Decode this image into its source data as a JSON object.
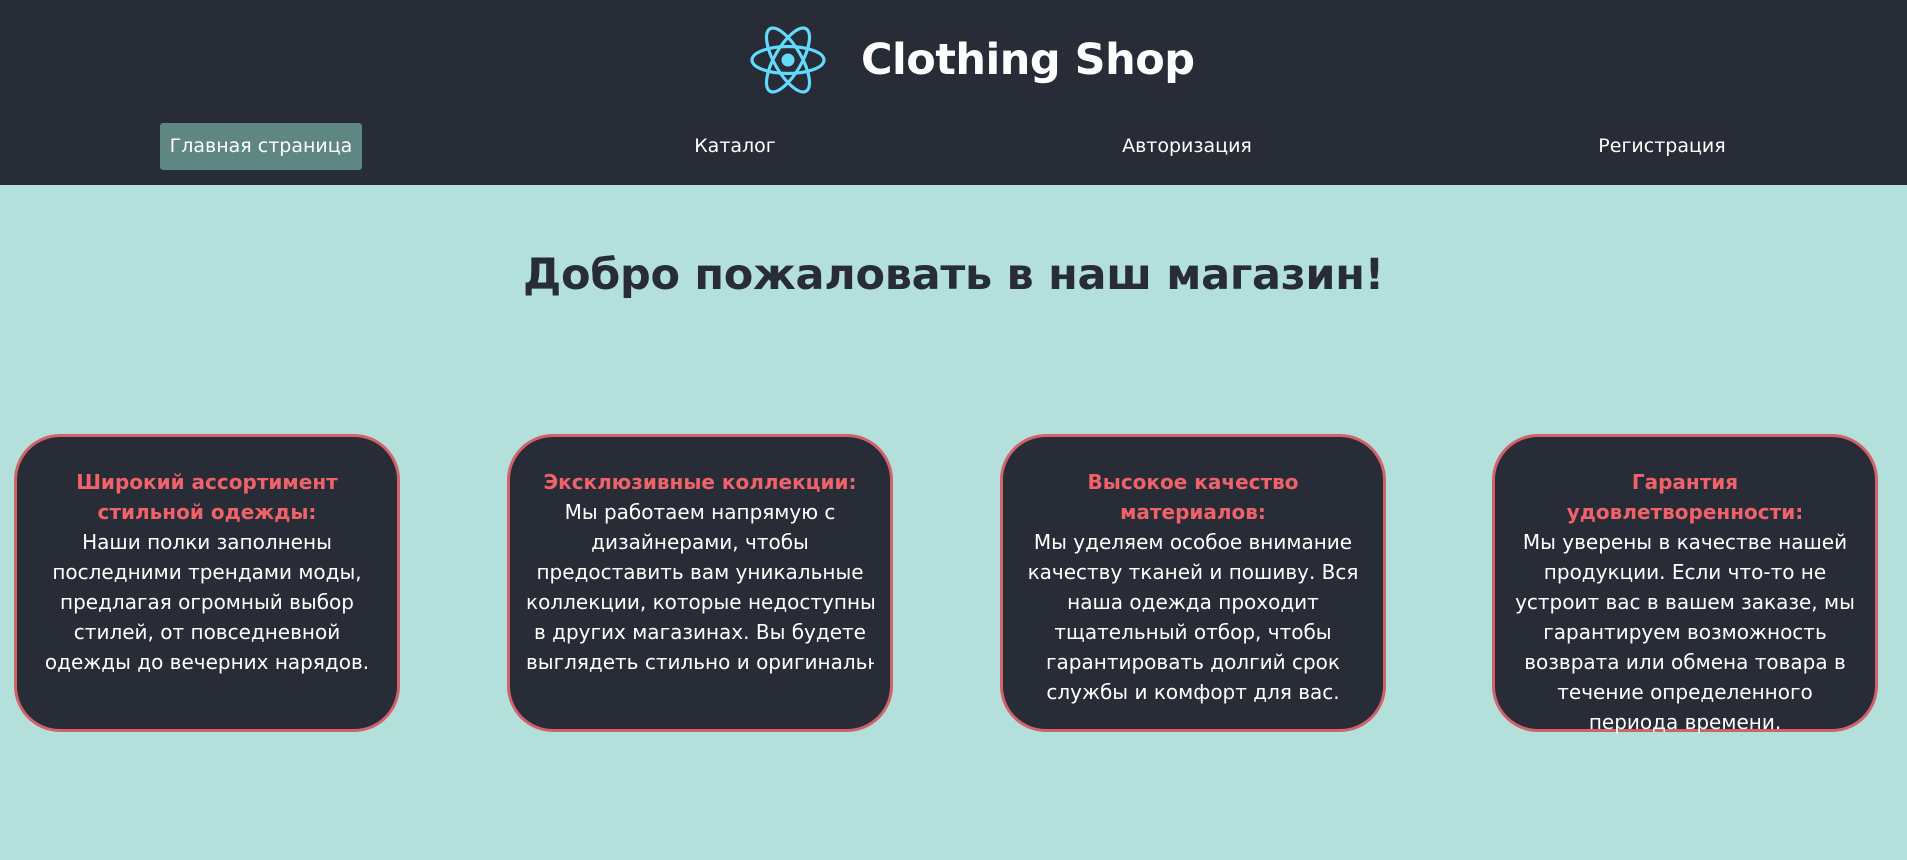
{
  "header": {
    "logo_icon": "react-atom-icon",
    "logo_color": "#61dafb",
    "title": "Clothing Shop",
    "background": "#282c36"
  },
  "nav": {
    "items": [
      {
        "label": "Главная страница",
        "active": true
      },
      {
        "label": "Каталог",
        "active": false
      },
      {
        "label": "Авторизация",
        "active": false
      },
      {
        "label": "Регистрация",
        "active": false
      }
    ],
    "active_color": "#5e8683"
  },
  "main": {
    "heading": "Добро пожаловать в наш магазин!",
    "background": "#b4e0dc",
    "cards": [
      {
        "title": "Широкий ассортимент стильной одежды:",
        "text": "Наши полки заполнены последними трендами моды, предлагая огромный выбор стилей, от повседневной одежды до вечерних нарядов."
      },
      {
        "title": "Эксклюзивные коллекции:",
        "text_lines": [
          "Мы работаем напрямую с",
          "дизайнерами, чтобы",
          "предоставить вам уникальные",
          "коллекции, которые недоступны",
          "в других магазинах. Вы будете",
          "выглядеть стильно и оригинальн"
        ]
      },
      {
        "title": "Высокое качество материалов:",
        "text": "Мы уделяем особое внимание качеству тканей и пошиву. Вся наша одежда проходит тщательный отбор, чтобы гарантировать долгий срок службы и комфорт для вас."
      },
      {
        "title": "Гарантия удовлетворенности:",
        "text": "Мы уверены в качестве нашей продукции. Если что-то не устроит вас в вашем заказе, мы гарантируем возможность возврата или обмена товара в течение определенного периода времени."
      }
    ],
    "card_border_color": "#d2626a",
    "card_title_color": "#f0626a"
  }
}
